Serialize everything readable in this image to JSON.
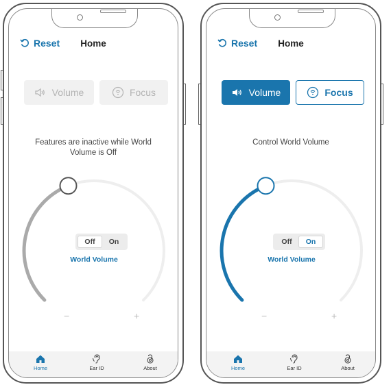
{
  "colors": {
    "accent": "#1a75ad",
    "inactive_arc": "#aaaaaa",
    "track": "#eeeeee",
    "disabled_bg": "#f1f1f1",
    "disabled_text": "#b3b3b3"
  },
  "screens": [
    {
      "header": {
        "reset_label": "Reset",
        "title": "Home"
      },
      "modes": {
        "volume_label": "Volume",
        "focus_label": "Focus",
        "selected": "none",
        "enabled": false
      },
      "message": "Features are inactive while World Volume is Off",
      "dial": {
        "level": 0.42,
        "minus": "−",
        "plus": "+",
        "label": "World Volume",
        "state": "off"
      },
      "toggle": {
        "off_label": "Off",
        "on_label": "On",
        "selected": "off"
      },
      "tabs": [
        {
          "label": "Home",
          "icon": "home-icon",
          "active": true
        },
        {
          "label": "Ear ID",
          "icon": "ear-icon",
          "active": false
        },
        {
          "label": "About",
          "icon": "about-icon",
          "active": false
        }
      ]
    },
    {
      "header": {
        "reset_label": "Reset",
        "title": "Home"
      },
      "modes": {
        "volume_label": "Volume",
        "focus_label": "Focus",
        "selected": "volume",
        "enabled": true
      },
      "message": "Control World Volume",
      "dial": {
        "level": 0.42,
        "minus": "−",
        "plus": "+",
        "label": "World Volume",
        "state": "on"
      },
      "toggle": {
        "off_label": "Off",
        "on_label": "On",
        "selected": "on"
      },
      "tabs": [
        {
          "label": "Home",
          "icon": "home-icon",
          "active": true
        },
        {
          "label": "Ear ID",
          "icon": "ear-icon",
          "active": false
        },
        {
          "label": "About",
          "icon": "about-icon",
          "active": false
        }
      ]
    }
  ]
}
